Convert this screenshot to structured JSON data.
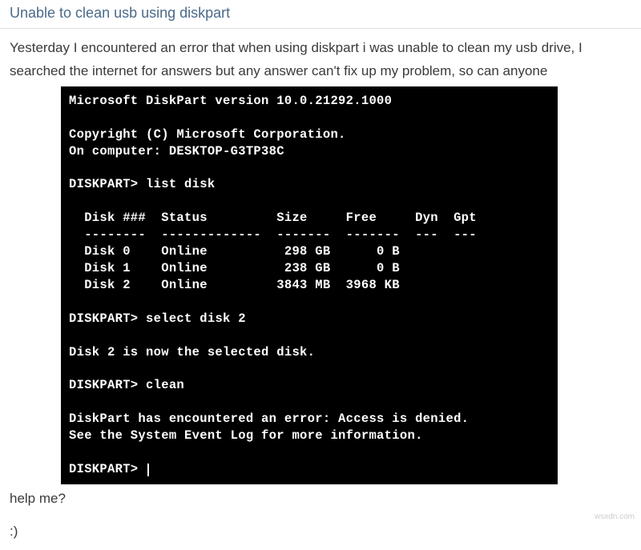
{
  "post": {
    "title": "Unable to clean usb using diskpart",
    "body_before": "Yesterday I encountered an error that when using diskpart i was unable to clean my usb drive, I searched the internet for answers but any answer can't fix up my problem, so can anyone",
    "body_after": "help me?",
    "smile": ":)"
  },
  "terminal": {
    "header1": "Microsoft DiskPart version 10.0.21292.1000",
    "copyright": "Copyright (C) Microsoft Corporation.",
    "computer": "On computer: DESKTOP-G3TP38C",
    "prompt": "DISKPART>",
    "cmd_list": "list disk",
    "table_header": "  Disk ###  Status         Size     Free     Dyn  Gpt",
    "table_sep": "  --------  -------------  -------  -------  ---  ---",
    "rows": [
      "  Disk 0    Online          298 GB      0 B",
      "  Disk 1    Online          238 GB      0 B",
      "  Disk 2    Online         3843 MB  3968 KB"
    ],
    "cmd_select": "select disk 2",
    "selected_msg": "Disk 2 is now the selected disk.",
    "cmd_clean": "clean",
    "error1": "DiskPart has encountered an error: Access is denied.",
    "error2": "See the System Event Log for more information."
  },
  "watermark": "wsxdn.com"
}
